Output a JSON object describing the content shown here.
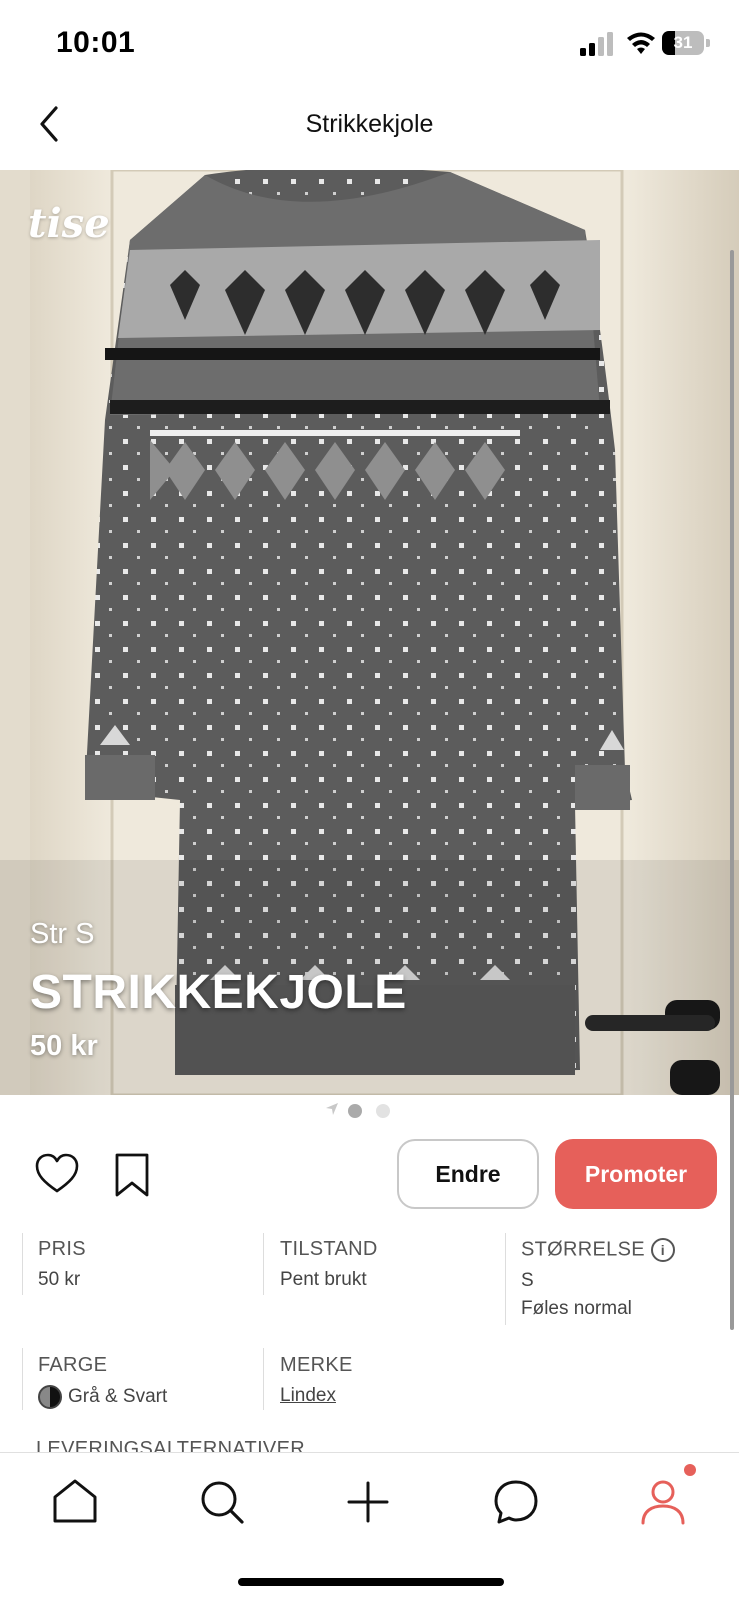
{
  "status_bar": {
    "time": "10:01",
    "battery": "31",
    "battery_level": 0.31
  },
  "header": {
    "title": "Strikkekjole"
  },
  "hero": {
    "logo": "tise",
    "size_label": "Str S",
    "title": "STRIKKEKJOLE",
    "price": "50 kr",
    "pager": {
      "count": 2,
      "active": 0
    }
  },
  "actions": {
    "edit_label": "Endre",
    "promote_label": "Promoter"
  },
  "attributes": {
    "price": {
      "label": "PRIS",
      "value": "50 kr"
    },
    "condition": {
      "label": "TILSTAND",
      "value": "Pent brukt"
    },
    "size": {
      "label": "STØRRELSE",
      "value": "S",
      "note": "Føles normal"
    },
    "color": {
      "label": "FARGE",
      "value": "Grå & Svart"
    },
    "brand": {
      "label": "MERKE",
      "value": "Lindex"
    },
    "delivery": {
      "label": "LEVERINGSALTERNATIVER"
    }
  },
  "tab_bar": {
    "items": [
      "home-icon",
      "search-icon",
      "plus-icon",
      "chat-icon",
      "profile-icon"
    ],
    "active": "profile-icon"
  },
  "colors": {
    "accent": "#e6605a",
    "text": "#222222"
  }
}
